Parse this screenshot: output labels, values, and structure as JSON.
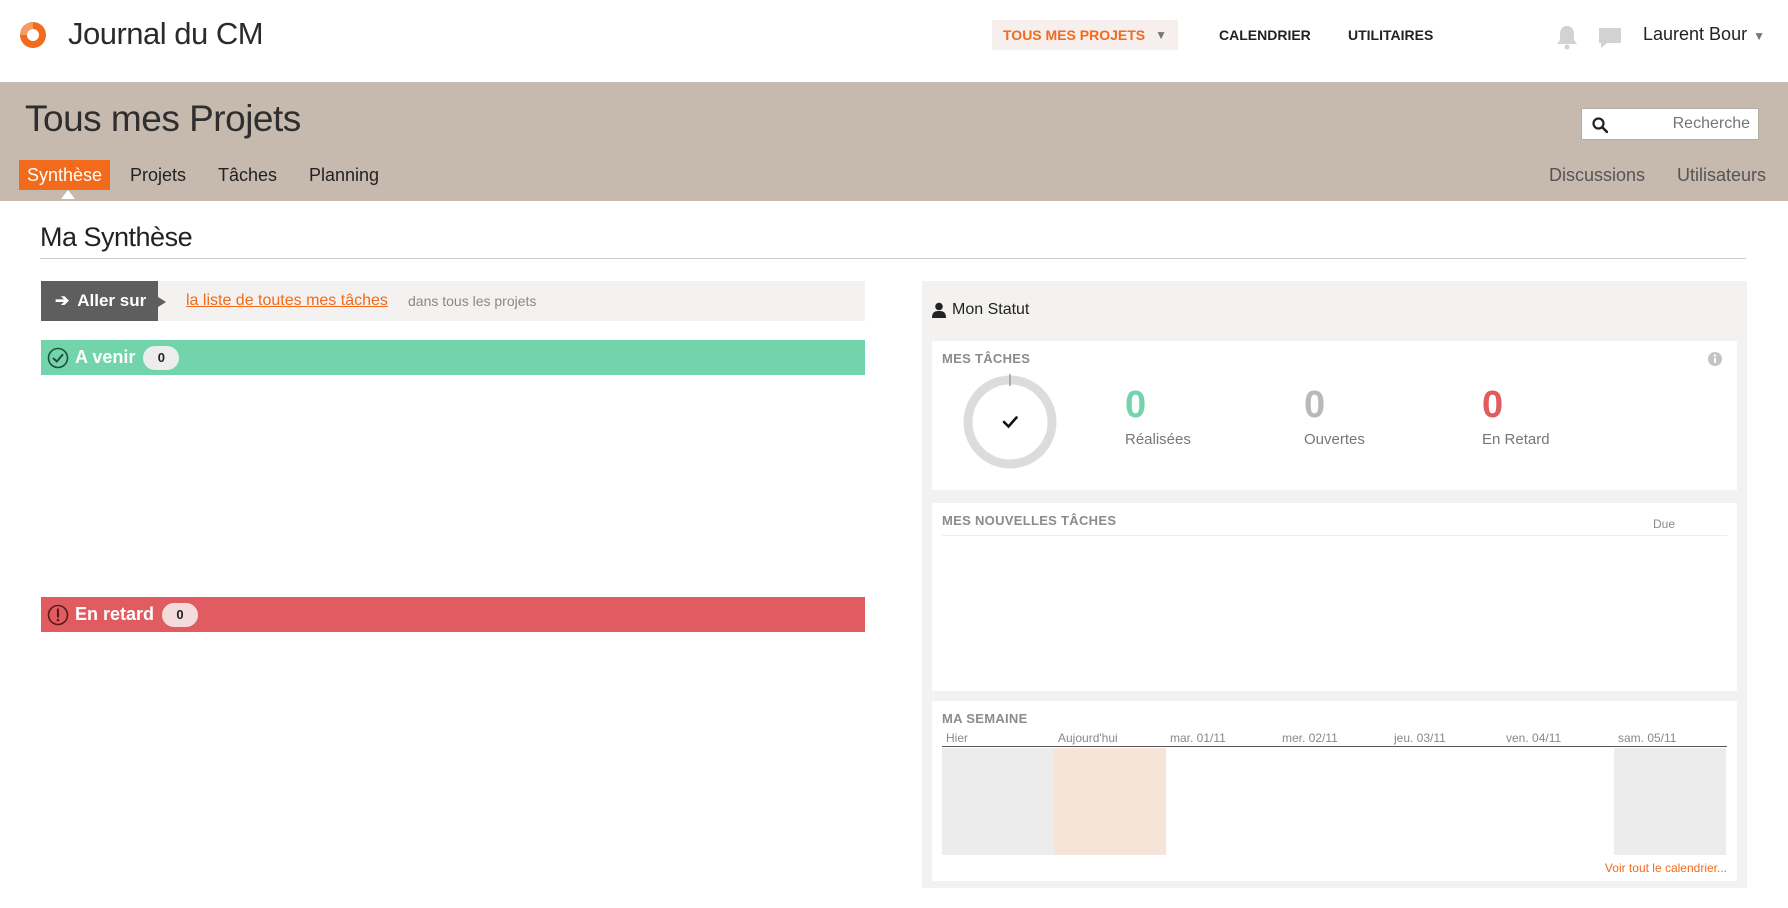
{
  "app": {
    "title": "Journal du CM",
    "brand_color": "#f26a1b"
  },
  "topnav": {
    "projects_label": "TOUS MES PROJETS",
    "calendar_label": "CALENDRIER",
    "utilities_label": "UTILITAIRES",
    "user_name": "Laurent Bour"
  },
  "header": {
    "title": "Tous mes Projets",
    "search_placeholder": "Recherche",
    "tabs_left": [
      "Synthèse",
      "Projets",
      "Tâches",
      "Planning"
    ],
    "tabs_right": [
      "Discussions",
      "Utilisateurs"
    ],
    "active_tab": "Synthèse"
  },
  "main": {
    "section_title": "Ma Synthèse",
    "goto": {
      "button_label": "Aller sur",
      "link_text": "la liste de toutes mes tâches",
      "hint": "dans tous les projets"
    },
    "upcoming": {
      "label": "A venir",
      "count": "0",
      "color": "#72d4aa"
    },
    "late": {
      "label": "En retard",
      "count": "0",
      "color": "#e05c60"
    }
  },
  "panel": {
    "title": "Mon Statut",
    "tasks": {
      "title": "MES TÂCHES",
      "done": {
        "value": "0",
        "label": "Réalisées"
      },
      "open": {
        "value": "0",
        "label": "Ouvertes"
      },
      "late": {
        "value": "0",
        "label": "En Retard"
      }
    },
    "new_tasks": {
      "title": "MES NOUVELLES TÂCHES",
      "due_label": "Due"
    },
    "week": {
      "title": "MA SEMAINE",
      "days": [
        "Hier",
        "Aujourd'hui",
        "mar. 01/11",
        "mer. 02/11",
        "jeu. 03/11",
        "ven. 04/11",
        "sam. 05/11"
      ],
      "link_text": "Voir tout le calendrier..."
    }
  }
}
